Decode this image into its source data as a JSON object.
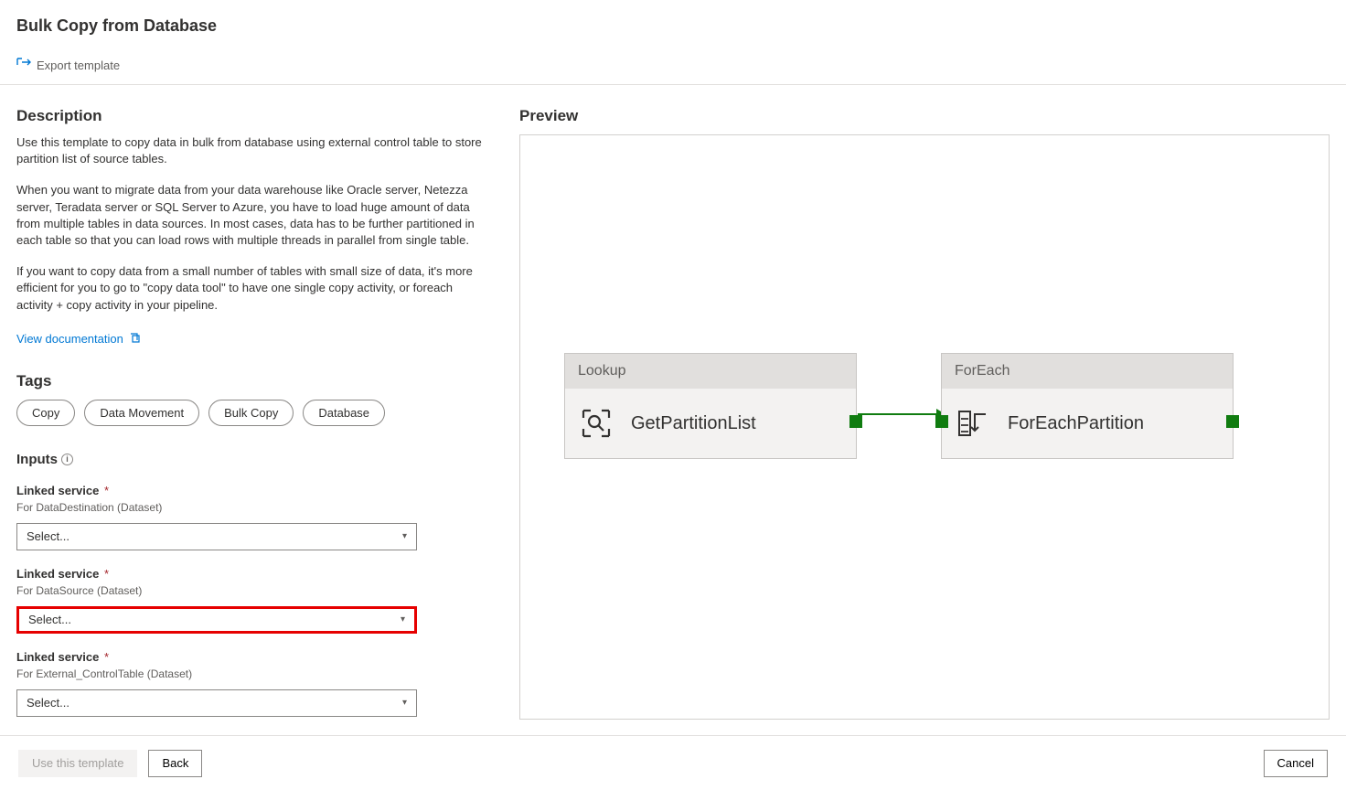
{
  "page_title": "Bulk Copy from Database",
  "toolbar": {
    "export_label": "Export template"
  },
  "description": {
    "heading": "Description",
    "p1": "Use this template to copy data in bulk from database using external control table to store partition list of source tables.",
    "p2": "When you want to migrate data from your data warehouse like Oracle server, Netezza server, Teradata server or SQL Server to Azure, you have to load huge amount of data from multiple tables in data sources. In most cases, data has to be further partitioned in each table so that you can load rows with multiple threads in parallel from single table.",
    "p3": "If you want to copy data from a small number of tables with small size of data, it's more efficient for you to go to \"copy data tool\" to have one single copy activity, or foreach activity + copy activity in your pipeline.",
    "doc_link": "View documentation"
  },
  "tags": {
    "heading": "Tags",
    "items": [
      "Copy",
      "Data Movement",
      "Bulk Copy",
      "Database"
    ]
  },
  "inputs": {
    "heading": "Inputs",
    "groups": [
      {
        "label": "Linked service",
        "required": "*",
        "sublabel": "For DataDestination (Dataset)",
        "value": "Select..."
      },
      {
        "label": "Linked service",
        "required": "*",
        "sublabel": "For DataSource (Dataset)",
        "value": "Select..."
      },
      {
        "label": "Linked service",
        "required": "*",
        "sublabel": "For External_ControlTable (Dataset)",
        "value": "Select..."
      }
    ]
  },
  "preview": {
    "heading": "Preview",
    "nodes": [
      {
        "type": "Lookup",
        "title": "GetPartitionList"
      },
      {
        "type": "ForEach",
        "title": "ForEachPartition"
      }
    ]
  },
  "footer": {
    "use_template": "Use this template",
    "back": "Back",
    "cancel": "Cancel"
  }
}
